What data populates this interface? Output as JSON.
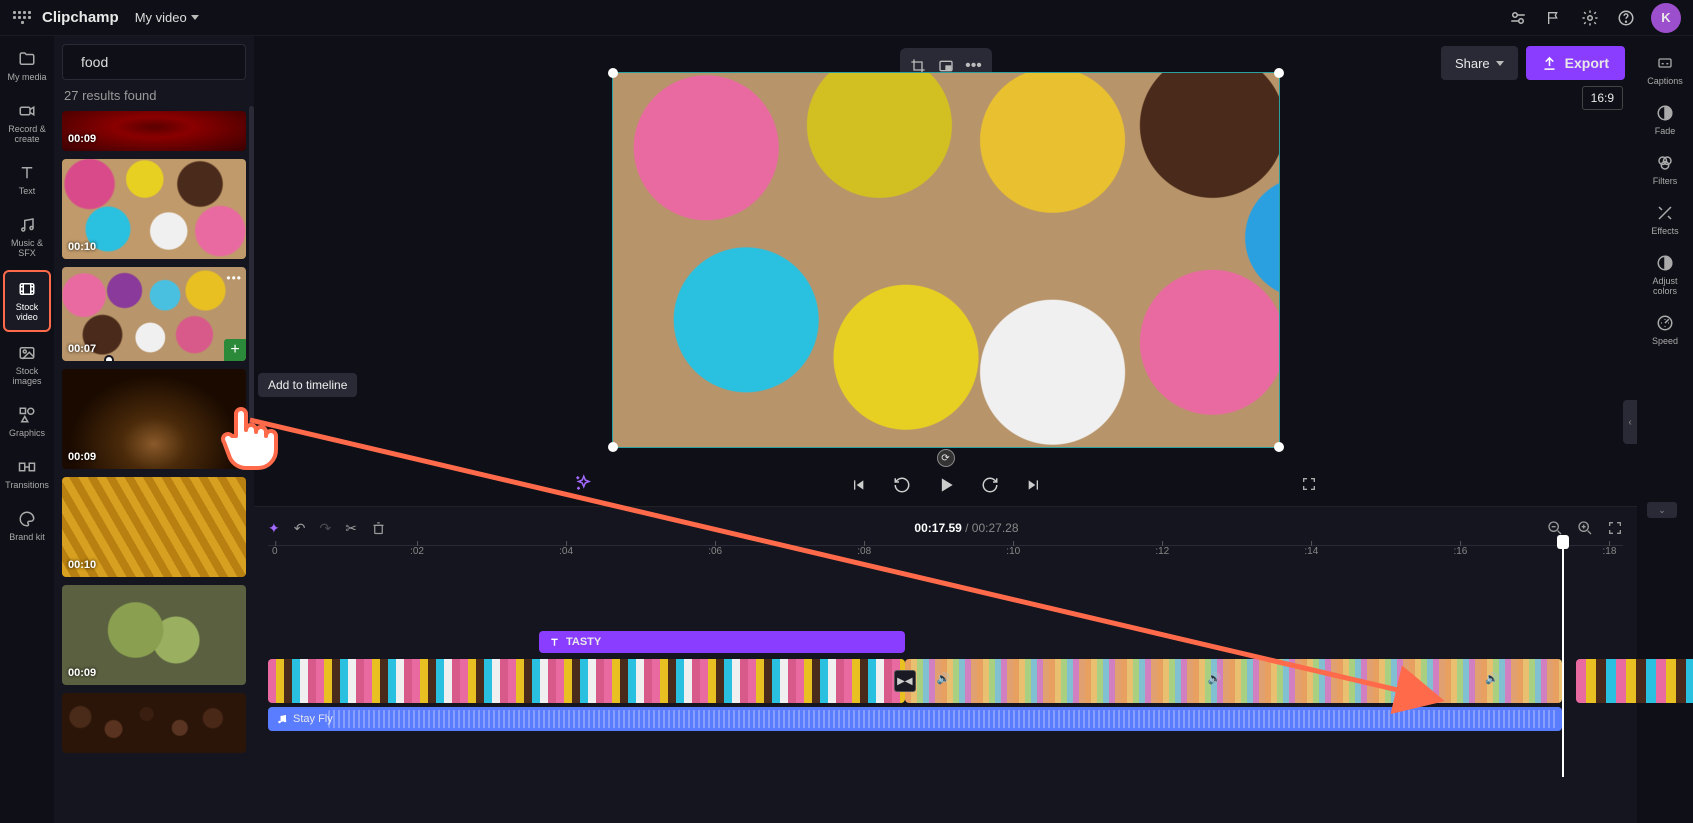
{
  "brand": "Clipchamp",
  "project_name": "My video",
  "avatar_initial": "K",
  "rail": [
    {
      "label": "My media"
    },
    {
      "label": "Record & create"
    },
    {
      "label": "Text"
    },
    {
      "label": "Music & SFX"
    },
    {
      "label": "Stock video"
    },
    {
      "label": "Stock images"
    },
    {
      "label": "Graphics"
    },
    {
      "label": "Transitions"
    },
    {
      "label": "Brand kit"
    }
  ],
  "search": {
    "value": "food",
    "placeholder": "Search"
  },
  "results_text": "27 results found",
  "thumbs": [
    {
      "dur": "00:09"
    },
    {
      "dur": "00:10"
    },
    {
      "dur": "00:07"
    },
    {
      "dur": "00:09"
    },
    {
      "dur": "00:10"
    },
    {
      "dur": "00:09"
    }
  ],
  "tooltip_add": "Add to timeline",
  "share_label": "Share",
  "export_label": "Export",
  "aspect_label": "16:9",
  "time_current": "00:17.59",
  "time_total": "/ 00:27.28",
  "ticks": [
    "0",
    ":02",
    ":04",
    ":06",
    ":08",
    ":10",
    ":12",
    ":14",
    ":16",
    ":18"
  ],
  "text_clip_label": "TASTY",
  "audio_clip_label": "Stay Fly",
  "rrail": [
    {
      "label": "Captions"
    },
    {
      "label": "Fade"
    },
    {
      "label": "Filters"
    },
    {
      "label": "Effects"
    },
    {
      "label": "Adjust colors"
    },
    {
      "label": "Speed"
    }
  ]
}
